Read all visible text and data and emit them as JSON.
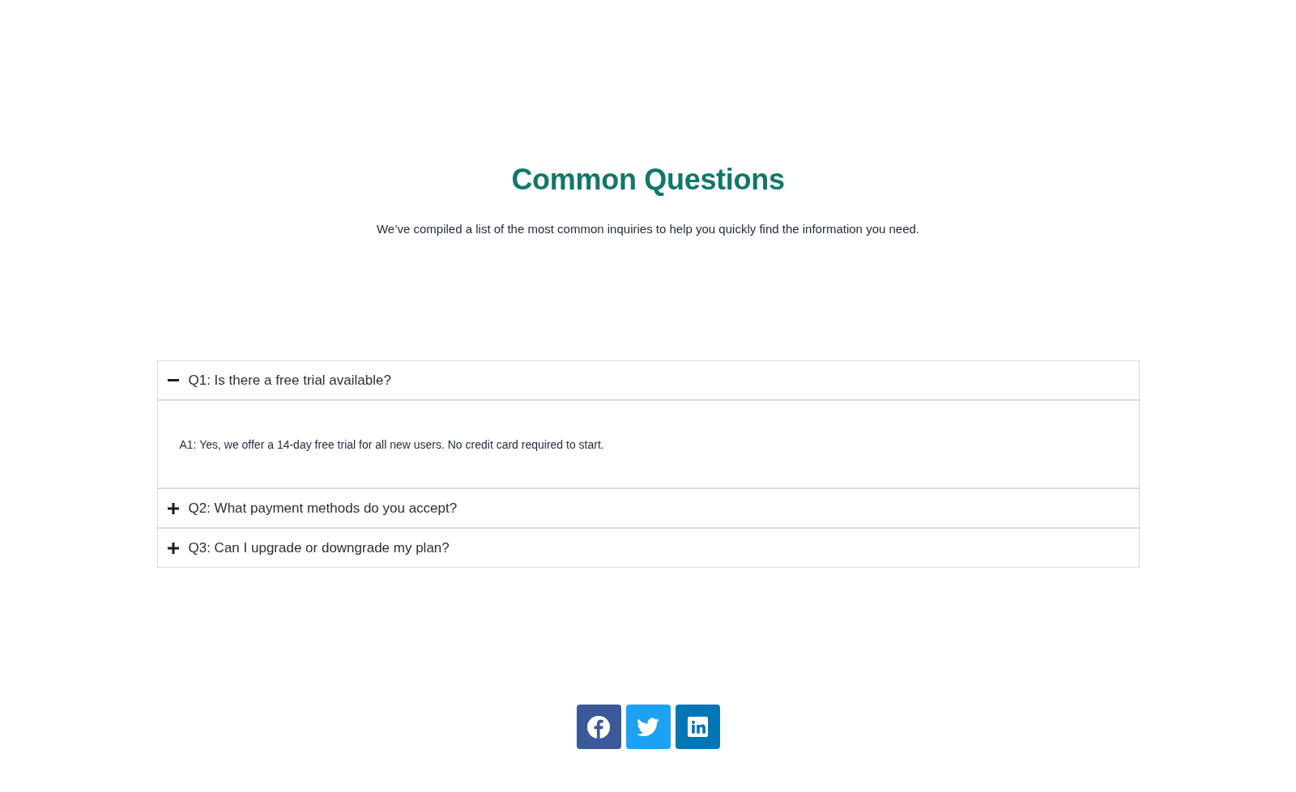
{
  "heading": "Common Questions",
  "intro": "We’ve compiled a list of the most common inquiries to help you quickly find the information you need.",
  "faq": [
    {
      "question": "Q1: Is there a free trial available?",
      "expanded": true,
      "answer": "A1: Yes, we offer a 14-day free trial for all new users. No credit card required to start."
    },
    {
      "question": "Q2: What payment methods do you accept?",
      "expanded": false
    },
    {
      "question": "Q3: Can I upgrade or downgrade my plan?",
      "expanded": false
    }
  ],
  "social_links": [
    {
      "kind": "facebook",
      "color": "#3b5998"
    },
    {
      "kind": "twitter",
      "color": "#1da1f2"
    },
    {
      "kind": "linkedin",
      "color": "#0077b5"
    }
  ]
}
